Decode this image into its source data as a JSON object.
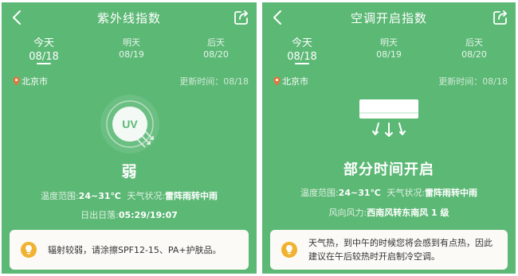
{
  "left_panel": {
    "title": "紫外线指数",
    "tabs": [
      {
        "name": "今天",
        "date": "08/18"
      },
      {
        "name": "明天",
        "date": "08/19"
      },
      {
        "name": "后天",
        "date": "08/20"
      }
    ],
    "city": "北京市",
    "update_label": "更新时间：",
    "update_time": "08/18",
    "badge": "UV",
    "level": "弱",
    "temp_label": "温度范围:",
    "temp_value": "24~31℃",
    "weather_label": "天气状况:",
    "weather_value": "雷阵雨转中雨",
    "sun_label": "日出日落:",
    "sun_value": "05:29/19:07",
    "tip": "辐射较弱，请涂擦SPF12-15、PA+护肤品。"
  },
  "right_panel": {
    "title": "空调开启指数",
    "tabs": [
      {
        "name": "今天",
        "date": "08/18"
      },
      {
        "name": "明天",
        "date": "08/19"
      },
      {
        "name": "后天",
        "date": "08/20"
      }
    ],
    "city": "北京市",
    "update_label": "更新时间：",
    "update_time": "08/18",
    "level": "部分时间开启",
    "temp_label": "温度范围:",
    "temp_value": "24~31℃",
    "weather_label": "天气状况:",
    "weather_value": "雷阵雨转中雨",
    "wind_label": "风向风力:",
    "wind_value": "西南风转东南风 1 级",
    "tip": "天气热，到中午的时候您将会感到有点热，因此建议在午后较热时开启制冷空调。"
  },
  "colors": {
    "background": "#5cb875",
    "card": "#fbfaf6",
    "bulb": "#f0b230"
  },
  "icons": [
    "back-arrow-icon",
    "share-icon",
    "location-pin-icon",
    "uv-icon",
    "air-conditioner-icon",
    "lightbulb-icon"
  ]
}
